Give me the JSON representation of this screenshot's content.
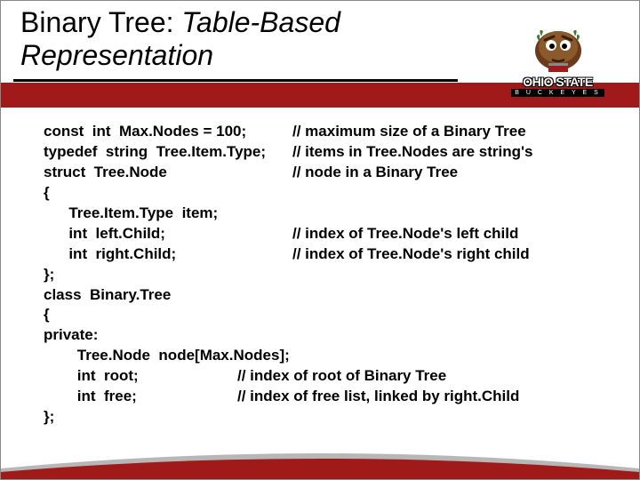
{
  "title": {
    "line1_plain": "Binary Tree: ",
    "line1_italic": "Table-Based",
    "line2_italic": "Representation"
  },
  "logo": {
    "name": "OHIO STATE",
    "sub": "B U C K E Y E S"
  },
  "code": {
    "l1_left": "const  int  Max.Nodes = 100;",
    "l1_right": "// maximum size of a Binary Tree",
    "l2_left": "typedef  string  Tree.Item.Type;",
    "l2_right": "// items in Tree.Nodes are string's",
    "l3_left": "struct  Tree.Node",
    "l3_right": "// node in a Binary Tree",
    "l4": "{",
    "l5": "      Tree.Item.Type  item;",
    "l6_left": "      int  left.Child;",
    "l6_right": "// index of Tree.Node's left child",
    "l7_left": "      int  right.Child;",
    "l7_right": "// index of Tree.Node's right child",
    "l8": "};",
    "l9": "class  Binary.Tree",
    "l10": "{",
    "l11": "private:",
    "l12": "        Tree.Node  node[Max.Nodes];",
    "l13_left": "        int  root;",
    "l13_right": "// index of root of Binary Tree",
    "l14_left": "        int  free;",
    "l14_right": "// index of free list, linked by right.Child",
    "l15": "};"
  }
}
